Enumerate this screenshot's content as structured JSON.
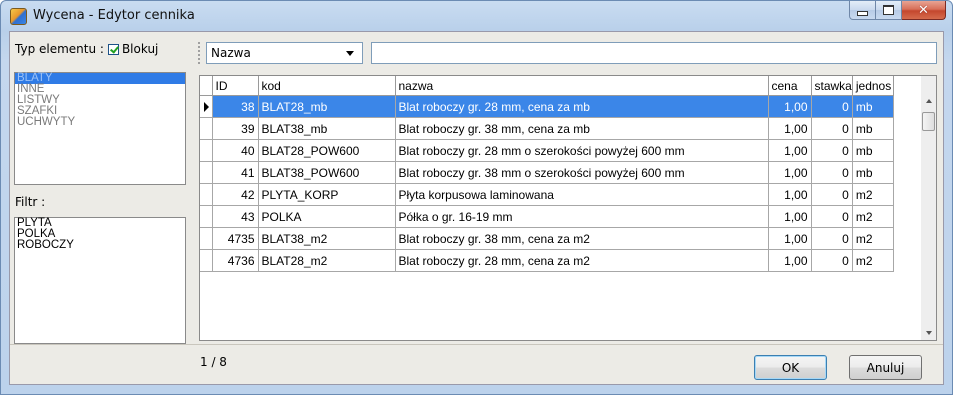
{
  "window": {
    "title": "Wycena - Edytor cennika",
    "icon": "app-icon",
    "controls": [
      "minimize",
      "maximize",
      "close"
    ],
    "close_glyph": "✕"
  },
  "left": {
    "type_label": "Typ elementu :",
    "block_label": "Blokuj",
    "block_checked": true,
    "types": [
      "BLATY",
      "INNE",
      "LISTWY",
      "SZAFKI",
      "UCHWYTY"
    ],
    "selected_type": "BLATY",
    "filter_label": "Filtr :",
    "filters": [
      "PLYTA",
      "POLKA",
      "ROBOCZY"
    ]
  },
  "toolbar": {
    "search_field_value": "Nazwa",
    "search_text": ""
  },
  "grid": {
    "columns": [
      "ID",
      "kod",
      "nazwa",
      "cena",
      "stawka",
      "jednos"
    ],
    "rows": [
      {
        "id": "38",
        "kod": "BLAT28_mb",
        "nazwa": "Blat roboczy gr. 28 mm, cena za mb",
        "cena": "1,00",
        "stawka": "0",
        "jedn": "mb"
      },
      {
        "id": "39",
        "kod": "BLAT38_mb",
        "nazwa": "Blat roboczy gr. 38 mm, cena za mb",
        "cena": "1,00",
        "stawka": "0",
        "jedn": "mb"
      },
      {
        "id": "40",
        "kod": "BLAT28_POW600",
        "nazwa": "Blat roboczy gr. 28 mm o szerokości powyżej 600 mm",
        "cena": "1,00",
        "stawka": "0",
        "jedn": "mb"
      },
      {
        "id": "41",
        "kod": "BLAT38_POW600",
        "nazwa": "Blat roboczy gr. 38 mm o szerokości powyżej 600 mm",
        "cena": "1,00",
        "stawka": "0",
        "jedn": "mb"
      },
      {
        "id": "42",
        "kod": "PLYTA_KORP",
        "nazwa": "Płyta korpusowa laminowana",
        "cena": "1,00",
        "stawka": "0",
        "jedn": "m2"
      },
      {
        "id": "43",
        "kod": "POLKA",
        "nazwa": "Półka o gr. 16-19 mm",
        "cena": "1,00",
        "stawka": "0",
        "jedn": "m2"
      },
      {
        "id": "4735",
        "kod": "BLAT38_m2",
        "nazwa": "Blat roboczy gr. 38 mm, cena za m2",
        "cena": "1,00",
        "stawka": "0",
        "jedn": "m2"
      },
      {
        "id": "4736",
        "kod": "BLAT28_m2",
        "nazwa": "Blat roboczy gr. 28 mm, cena za m2",
        "cena": "1,00",
        "stawka": "0",
        "jedn": "m2"
      }
    ],
    "selected_row": 0
  },
  "footer": {
    "pager": "1 / 8",
    "ok_label": "OK",
    "cancel_label": "Anuluj"
  },
  "colors": {
    "selection": "#3b86e8",
    "title_bar": "#c9dcf1",
    "close_button": "#c4472e"
  }
}
